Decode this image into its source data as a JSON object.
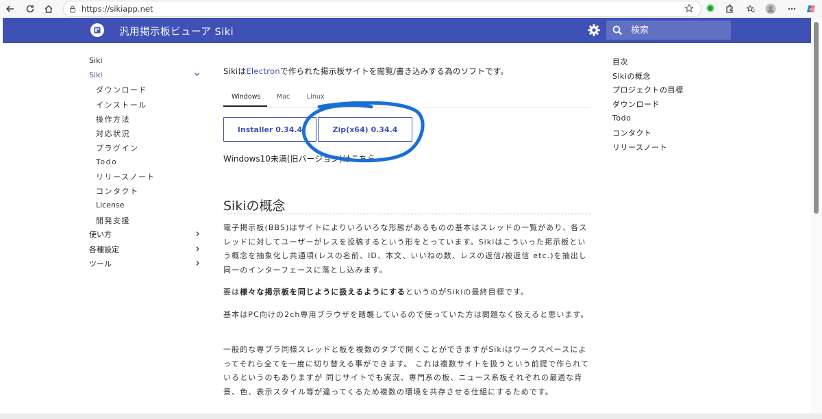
{
  "browser": {
    "url": "https://sikiapp.net"
  },
  "appbar": {
    "title": "汎用掲示板ビューア Siki",
    "search_placeholder": "検索",
    "color": "#3f51b5"
  },
  "leftnav": {
    "site_label": "Siki",
    "section_label": "Siki",
    "sub_items": [
      "ダウンロード",
      "インストール",
      "操作方法",
      "対応状況",
      "プラグイン",
      "Todo",
      "リリースノート",
      "コンタクト",
      "License",
      "開発支援"
    ],
    "sections": [
      "使い方",
      "各種設定",
      "ツール"
    ]
  },
  "main": {
    "intro_prefix": "Sikiは",
    "intro_link": "Electron",
    "intro_suffix": "で作られた掲示板サイトを閲覧/書き込みする為のソフトです。",
    "tabs": [
      "Windows",
      "Mac",
      "Linux"
    ],
    "active_tab": "Windows",
    "buttons": [
      "Installer 0.34.4",
      "Zip(x64) 0.34.4"
    ],
    "windows_note": "Windows10未満(旧バージョン)はこちら",
    "heading": "Sikiの概念",
    "para1": "電子掲示板(BBS)はサイトによりいろいろな形態があるものの基本はスレッドの一覧があり、各スレッドに対してユーザーがレスを投稿するという形をとっています。Sikiはこういった掲示板という概念を抽象化し共通項(レスの名前、ID、本文、いいねの数、レスの返信/被返信 etc.)を抽出し同一のインターフェースに落とし込みます。",
    "para2_prefix": "要は",
    "para2_bold": "様々な掲示板を同じように扱えるようにする",
    "para2_suffix": "というのがSikiの最終目標です。",
    "para3": "基本はPC向けの2ch専用ブラウザを踏襲しているので使っていた方は問題なく扱えると思います。",
    "para4": "一般的な専ブラ同様スレッドと板を複数のタブで開くことができますがSikiはワークスペースによってそれら全てを一度に切り替える事ができます。 これは複数サイトを扱うという前提で作られているというのもありますが 同じサイトでも実況、専門系の板、ニュース系板それぞれの最適な背景、色、表示スタイル等が違ってくるため複数の環境を共存させる仕組にするためです。"
  },
  "toc": {
    "title": "目次",
    "items": [
      "Sikiの概念",
      "プロジェクトの目標",
      "ダウンロード",
      "Todo",
      "コンタクト",
      "リリースノート"
    ]
  }
}
